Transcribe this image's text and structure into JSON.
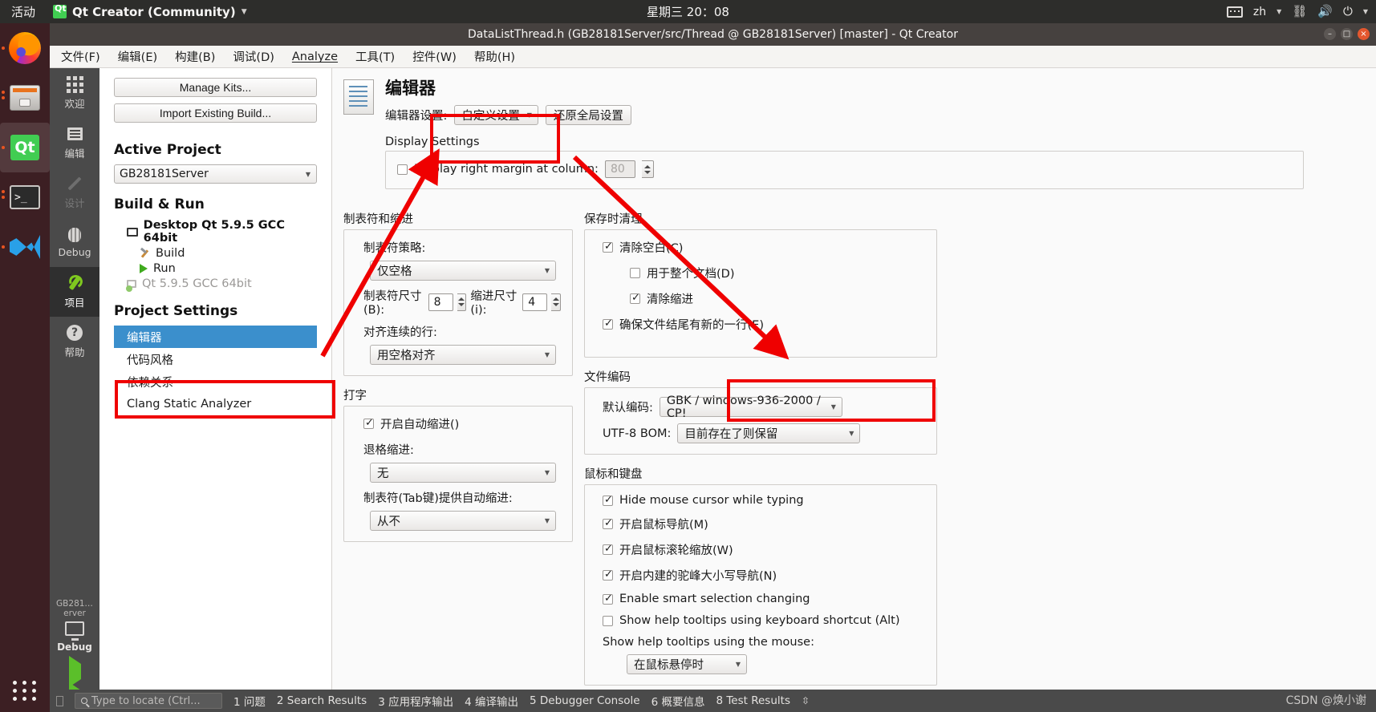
{
  "ubuntu_panel": {
    "activities": "活动",
    "app_name": "Qt Creator (Community)",
    "app_icon": "qt-icon",
    "caret_icon": "chevron-down-icon",
    "clock": "星期三 20：08",
    "tray": {
      "keyboard_icon": "keyboard-icon",
      "language": "zh",
      "network_icon": "network-icon",
      "volume_icon": "volume-icon",
      "power_icon": "power-icon"
    }
  },
  "dock": {
    "items": [
      {
        "name": "firefox",
        "icon": "firefox-icon",
        "running": true,
        "active": false
      },
      {
        "name": "files",
        "icon": "files-icon",
        "running": true,
        "active": false
      },
      {
        "name": "qtcreator",
        "icon": "qt-icon",
        "running": true,
        "active": true
      },
      {
        "name": "terminal",
        "icon": "terminal-icon",
        "running": true,
        "active": false
      },
      {
        "name": "vscode",
        "icon": "vscode-icon",
        "running": true,
        "active": false
      }
    ],
    "show_apps_icon": "grid-icon"
  },
  "window": {
    "title": "DataListThread.h (GB28181Server/src/Thread @ GB28181Server) [master] - Qt Creator",
    "minimize_icon": "minimize-icon",
    "maximize_icon": "maximize-icon",
    "close_icon": "close-icon"
  },
  "menubar": [
    {
      "label": "文件(F)",
      "mnemonic": "F"
    },
    {
      "label": "编辑(E)",
      "mnemonic": "E"
    },
    {
      "label": "构建(B)",
      "mnemonic": "B"
    },
    {
      "label": "调试(D)",
      "mnemonic": "D"
    },
    {
      "label": "Analyze",
      "mnemonic": "A"
    },
    {
      "label": "工具(T)",
      "mnemonic": "T"
    },
    {
      "label": "控件(W)",
      "mnemonic": "W"
    },
    {
      "label": "帮助(H)",
      "mnemonic": "H"
    }
  ],
  "modebar": {
    "modes": [
      {
        "label": "欢迎",
        "icon": "grid-icon",
        "state": "normal"
      },
      {
        "label": "编辑",
        "icon": "editor-icon",
        "state": "normal"
      },
      {
        "label": "设计",
        "icon": "pen-icon",
        "state": "disabled"
      },
      {
        "label": "Debug",
        "icon": "bug-icon",
        "state": "normal"
      },
      {
        "label": "项目",
        "icon": "wrench-icon",
        "state": "selected"
      },
      {
        "label": "帮助",
        "icon": "question-icon",
        "state": "normal"
      }
    ],
    "kit_selector": {
      "project": "GB281…erver",
      "kit_icon": "desktop-icon",
      "expand_icon": "chevron-right-icon",
      "build_config": "Debug"
    },
    "run_button_icon": "run-icon",
    "debug_button_icon": "debug-run-icon",
    "build_button_icon": "hammer-icon"
  },
  "project_pane": {
    "manage_kits_label": "Manage Kits...",
    "import_build_label": "Import Existing Build...",
    "active_project_heading": "Active Project",
    "active_project_value": "GB28181Server",
    "build_run_heading": "Build & Run",
    "kit_name": "Desktop Qt 5.9.5 GCC 64bit",
    "kit_children": [
      {
        "label": "Build",
        "icon": "hammer-icon"
      },
      {
        "label": "Run",
        "icon": "run-icon"
      }
    ],
    "add_kit_label": "Qt 5.9.5 GCC 64bit",
    "add_kit_icon": "add-kit-icon",
    "project_settings_heading": "Project Settings",
    "settings_items": [
      {
        "label": "编辑器",
        "selected": true
      },
      {
        "label": "代码风格",
        "selected": false
      },
      {
        "label": "依赖关系",
        "selected": false
      },
      {
        "label": "Clang Static Analyzer",
        "selected": false
      }
    ]
  },
  "editor_settings": {
    "icon": "document-settings-icon",
    "title": "编辑器",
    "settings_label": "编辑器设置:",
    "settings_value": "自定义设置",
    "restore_global_label": "还原全局设置",
    "display_settings": {
      "group_title": "Display Settings",
      "right_margin_label": "Display right margin at column:",
      "right_margin_checked": false,
      "right_margin_value": "80",
      "right_margin_disabled": true
    },
    "tabs_indent": {
      "group_title": "制表符和缩进",
      "tab_policy_label": "制表符策略:",
      "tab_policy_value": "仅空格",
      "tab_size_label": "制表符尺寸(B):",
      "tab_size_value": "8",
      "indent_size_label": "缩进尺寸(i):",
      "indent_size_value": "4",
      "align_continuation_label": "对齐连续的行:",
      "align_continuation_value": "用空格对齐"
    },
    "typing": {
      "group_title": "打字",
      "auto_indent_label": "开启自动缩进()",
      "auto_indent_checked": true,
      "backspace_label": "退格缩进:",
      "backspace_value": "无",
      "tab_key_label": "制表符(Tab键)提供自动缩进:",
      "tab_key_value": "从不"
    },
    "cleanup": {
      "group_title": "保存时清理",
      "items": [
        {
          "label": "清除空白(C)",
          "checked": true,
          "indent": 0
        },
        {
          "label": "用于整个文档(D)",
          "checked": false,
          "indent": 1
        },
        {
          "label": "清除缩进",
          "checked": true,
          "indent": 1
        },
        {
          "label": "确保文件结尾有新的一行(E)",
          "checked": true,
          "indent": 0
        }
      ]
    },
    "file_encoding": {
      "group_title": "文件编码",
      "default_encoding_label": "默认编码:",
      "default_encoding_value": "GBK / windows-936-2000 / CP!",
      "utf8_bom_label": "UTF-8 BOM:",
      "utf8_bom_value": "目前存在了则保留"
    },
    "mouse_keyboard": {
      "group_title": "鼠标和键盘",
      "items": [
        {
          "label": "Hide mouse cursor while typing",
          "checked": true
        },
        {
          "label": "开启鼠标导航(M)",
          "checked": true
        },
        {
          "label": "开启鼠标滚轮缩放(W)",
          "checked": true
        },
        {
          "label": "开启内建的驼峰大小写导航(N)",
          "checked": true
        },
        {
          "label": "Enable smart selection changing",
          "checked": true
        },
        {
          "label": "Show help tooltips using keyboard shortcut (Alt)",
          "checked": false
        }
      ],
      "tooltip_mouse_label": "Show help tooltips using the mouse:",
      "tooltip_mouse_value": "在鼠标悬停时"
    }
  },
  "statusbar": {
    "collapse_icon": "collapse-icon",
    "locate_placeholder": "Type to locate (Ctrl...",
    "search_icon": "search-icon",
    "panels": [
      "1 问题",
      "2 Search Results",
      "3 应用程序输出",
      "4 编译输出",
      "5 Debugger Console",
      "6 概要信息",
      "8 Test Results"
    ],
    "updown_icon": "updown-arrows-icon"
  },
  "watermark": "CSDN @焕小谢",
  "annotations": {
    "color": "#ef0000",
    "boxes": [
      {
        "name": "editor-settings-highlight"
      },
      {
        "name": "project-settings-editor-highlight"
      },
      {
        "name": "default-encoding-highlight"
      }
    ],
    "arrows": [
      {
        "name": "arrow-to-editor-settings"
      },
      {
        "name": "arrow-to-default-encoding"
      }
    ]
  }
}
